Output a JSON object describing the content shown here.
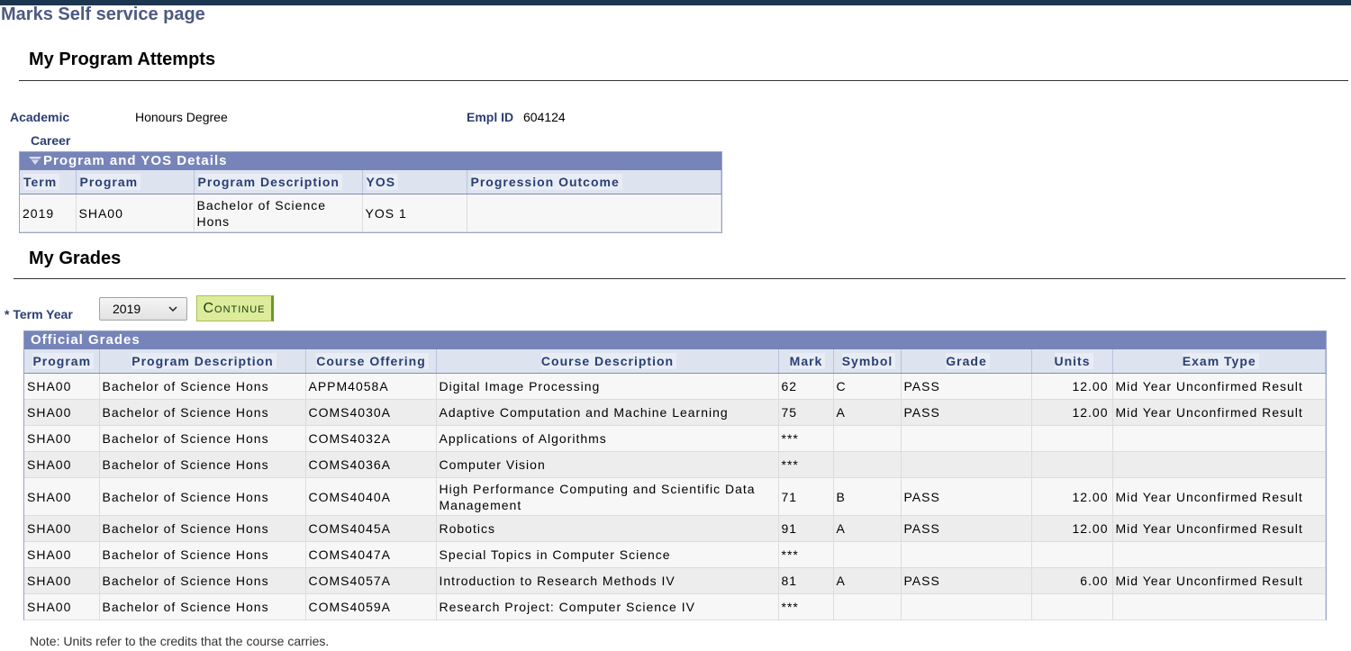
{
  "page_title": "Marks Self service page",
  "attempts": {
    "title": "My Program Attempts",
    "academic_career_label_1": "Academic",
    "academic_career_label_2": "Career",
    "academic_career_value": "Honours Degree",
    "empl_id_label": "Empl ID",
    "empl_id_value": "604124"
  },
  "program_grid": {
    "title": "Program and YOS Details",
    "columns": [
      "Term",
      "Program",
      "Program Description",
      "YOS",
      "Progression Outcome"
    ],
    "rows": [
      [
        "2019",
        "SHA00",
        "Bachelor of Science Hons",
        "YOS 1",
        ""
      ]
    ]
  },
  "grades": {
    "title": "My Grades",
    "term_year_label": "Term Year",
    "required_marker": "*",
    "term_year_value": "2019",
    "continue_label": "Continue",
    "note": "Note: Units refer to the credits that the course carries."
  },
  "grades_grid": {
    "title": "Official Grades",
    "columns": [
      "Program",
      "Program Description",
      "Course Offering",
      "Course Description",
      "Mark",
      "Symbol",
      "Grade",
      "Units",
      "Exam Type"
    ],
    "rows": [
      [
        "SHA00",
        "Bachelor of Science Hons",
        "APPM4058A",
        "Digital Image Processing",
        "62",
        "C",
        "PASS",
        "12.00",
        "Mid Year Unconfirmed Result"
      ],
      [
        "SHA00",
        "Bachelor of Science Hons",
        "COMS4030A",
        "Adaptive Computation and Machine Learning",
        "75",
        "A",
        "PASS",
        "12.00",
        "Mid Year Unconfirmed Result"
      ],
      [
        "SHA00",
        "Bachelor of Science Hons",
        "COMS4032A",
        "Applications of Algorithms",
        "***",
        "",
        "",
        "",
        ""
      ],
      [
        "SHA00",
        "Bachelor of Science Hons",
        "COMS4036A",
        "Computer Vision",
        "***",
        "",
        "",
        "",
        ""
      ],
      [
        "SHA00",
        "Bachelor of Science Hons",
        "COMS4040A",
        "High Performance Computing and Scientific Data Management",
        "71",
        "B",
        "PASS",
        "12.00",
        "Mid Year Unconfirmed Result"
      ],
      [
        "SHA00",
        "Bachelor of Science Hons",
        "COMS4045A",
        "Robotics",
        "91",
        "A",
        "PASS",
        "12.00",
        "Mid Year Unconfirmed Result"
      ],
      [
        "SHA00",
        "Bachelor of Science Hons",
        "COMS4047A",
        "Special Topics in Computer Science",
        "***",
        "",
        "",
        "",
        ""
      ],
      [
        "SHA00",
        "Bachelor of Science Hons",
        "COMS4057A",
        "Introduction to Research Methods IV",
        "81",
        "A",
        "PASS",
        "6.00",
        "Mid Year Unconfirmed Result"
      ],
      [
        "SHA00",
        "Bachelor of Science Hons",
        "COMS4059A",
        "Research Project: Computer Science IV",
        "***",
        "",
        "",
        "",
        ""
      ]
    ]
  }
}
